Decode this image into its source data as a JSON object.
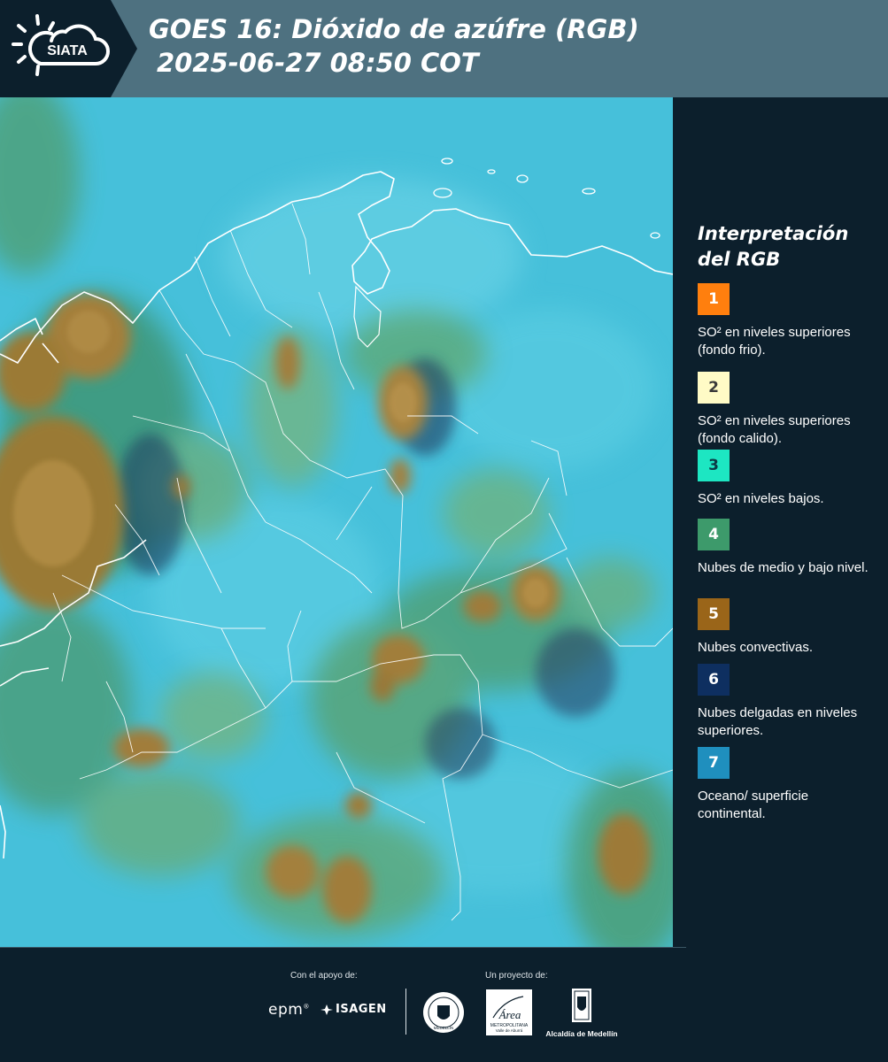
{
  "header": {
    "logo_text": "SIATA",
    "title_line1": "GOES 16: Dióxido de azúfre (RGB)",
    "title_line2": "2025-06-27 08:50 COT"
  },
  "map": {
    "product": "GOES 16 SO2 RGB composite",
    "region": "Colombia y Venezuela",
    "base_color": "#46c0da"
  },
  "legend": {
    "title_line1": "Interpretación",
    "title_line2": "del RGB",
    "items": [
      {
        "number": "1",
        "color": "#ff7f0e",
        "number_color": "#ffffff",
        "text": "SO² en niveles superiores (fondo frio)."
      },
      {
        "number": "2",
        "color": "#fffbc6",
        "number_color": "#3a3a3a",
        "text": "SO² en niveles superiores (fondo calido)."
      },
      {
        "number": "3",
        "color": "#1de6c2",
        "number_color": "#0c3b45",
        "text": "SO² en niveles bajos."
      },
      {
        "number": "4",
        "color": "#3d9a6b",
        "number_color": "#ffffff",
        "text": "Nubes de medio y bajo nivel."
      },
      {
        "number": "5",
        "color": "#9a6519",
        "number_color": "#ffffff",
        "text": "Nubes convectivas."
      },
      {
        "number": "6",
        "color": "#0e2f60",
        "number_color": "#ffffff",
        "text": "Nubes delgadas en niveles superiores."
      },
      {
        "number": "7",
        "color": "#1f8fbe",
        "number_color": "#ffffff",
        "text": "Oceano/ superficie continental."
      }
    ]
  },
  "footer": {
    "support_label": "Con el apoyo de:",
    "project_label": "Un proyecto de:",
    "epm": "epm",
    "isagen": "ISAGEN",
    "area_name": "Área",
    "area_sub1": "METROPOLITANA",
    "area_sub2": "Valle de Aburrá",
    "seal_text": "MEDELLÍN",
    "alcaldia": "Alcaldía de Medellín"
  }
}
